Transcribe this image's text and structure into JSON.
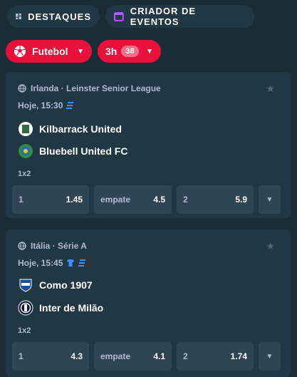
{
  "tabs": [
    {
      "label": "DESTAQUES",
      "icon": "dashboard-icon"
    },
    {
      "label": "CRIADOR DE EVENTOS",
      "icon": "calendar-icon"
    }
  ],
  "filters": {
    "sport": {
      "label": "Futebol",
      "icon": "soccer-ball-icon"
    },
    "time": {
      "label": "3h",
      "count": "38"
    }
  },
  "colors": {
    "accent": "#e9113c",
    "background": "#1a2c38",
    "card": "#213743",
    "button": "#2f4553",
    "muted": "#b1bad3"
  },
  "events": [
    {
      "league": "Irlanda · Leinster Senior League",
      "time": "Hoje, 15:30",
      "teams": [
        "Kilbarrack United",
        "Bluebell United FC"
      ],
      "market": "1x2",
      "odds": [
        {
          "label": "1",
          "value": "1.45"
        },
        {
          "label": "empate",
          "value": "4.5"
        },
        {
          "label": "2",
          "value": "5.9"
        }
      ]
    },
    {
      "league": "Itália · Série A",
      "time": "Hoje, 15:45",
      "teams": [
        "Como 1907",
        "Inter de Milão"
      ],
      "market": "1x2",
      "odds": [
        {
          "label": "1",
          "value": "4.3"
        },
        {
          "label": "empate",
          "value": "4.1"
        },
        {
          "label": "2",
          "value": "1.74"
        }
      ]
    }
  ]
}
